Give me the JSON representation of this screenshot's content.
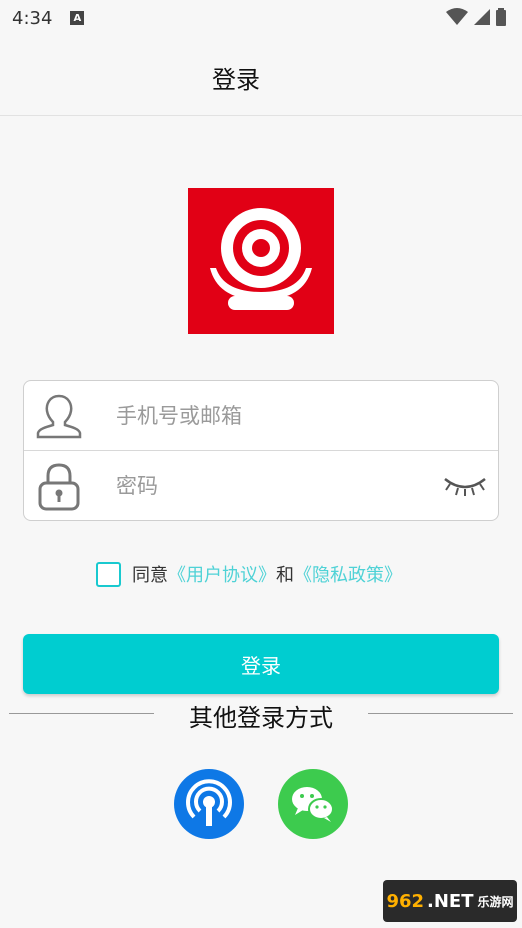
{
  "status_bar": {
    "time": "4:34",
    "notification_icon": "A"
  },
  "header": {
    "title": "登录"
  },
  "logo": {
    "icon": "webcam-logo-icon",
    "color": "#e10015"
  },
  "form": {
    "account_placeholder": "手机号或邮箱",
    "password_placeholder": "密码"
  },
  "agreement": {
    "prefix": "同意",
    "user_agreement": "《用户协议》",
    "conjunction": "和",
    "privacy_policy": "《隐私政策》"
  },
  "login_button": {
    "label": "登录",
    "color": "#00cdd0"
  },
  "other_login": {
    "label": "其他登录方式"
  },
  "watermark": {
    "number": "962",
    "suffix": ".NET",
    "sub": "乐游网"
  }
}
